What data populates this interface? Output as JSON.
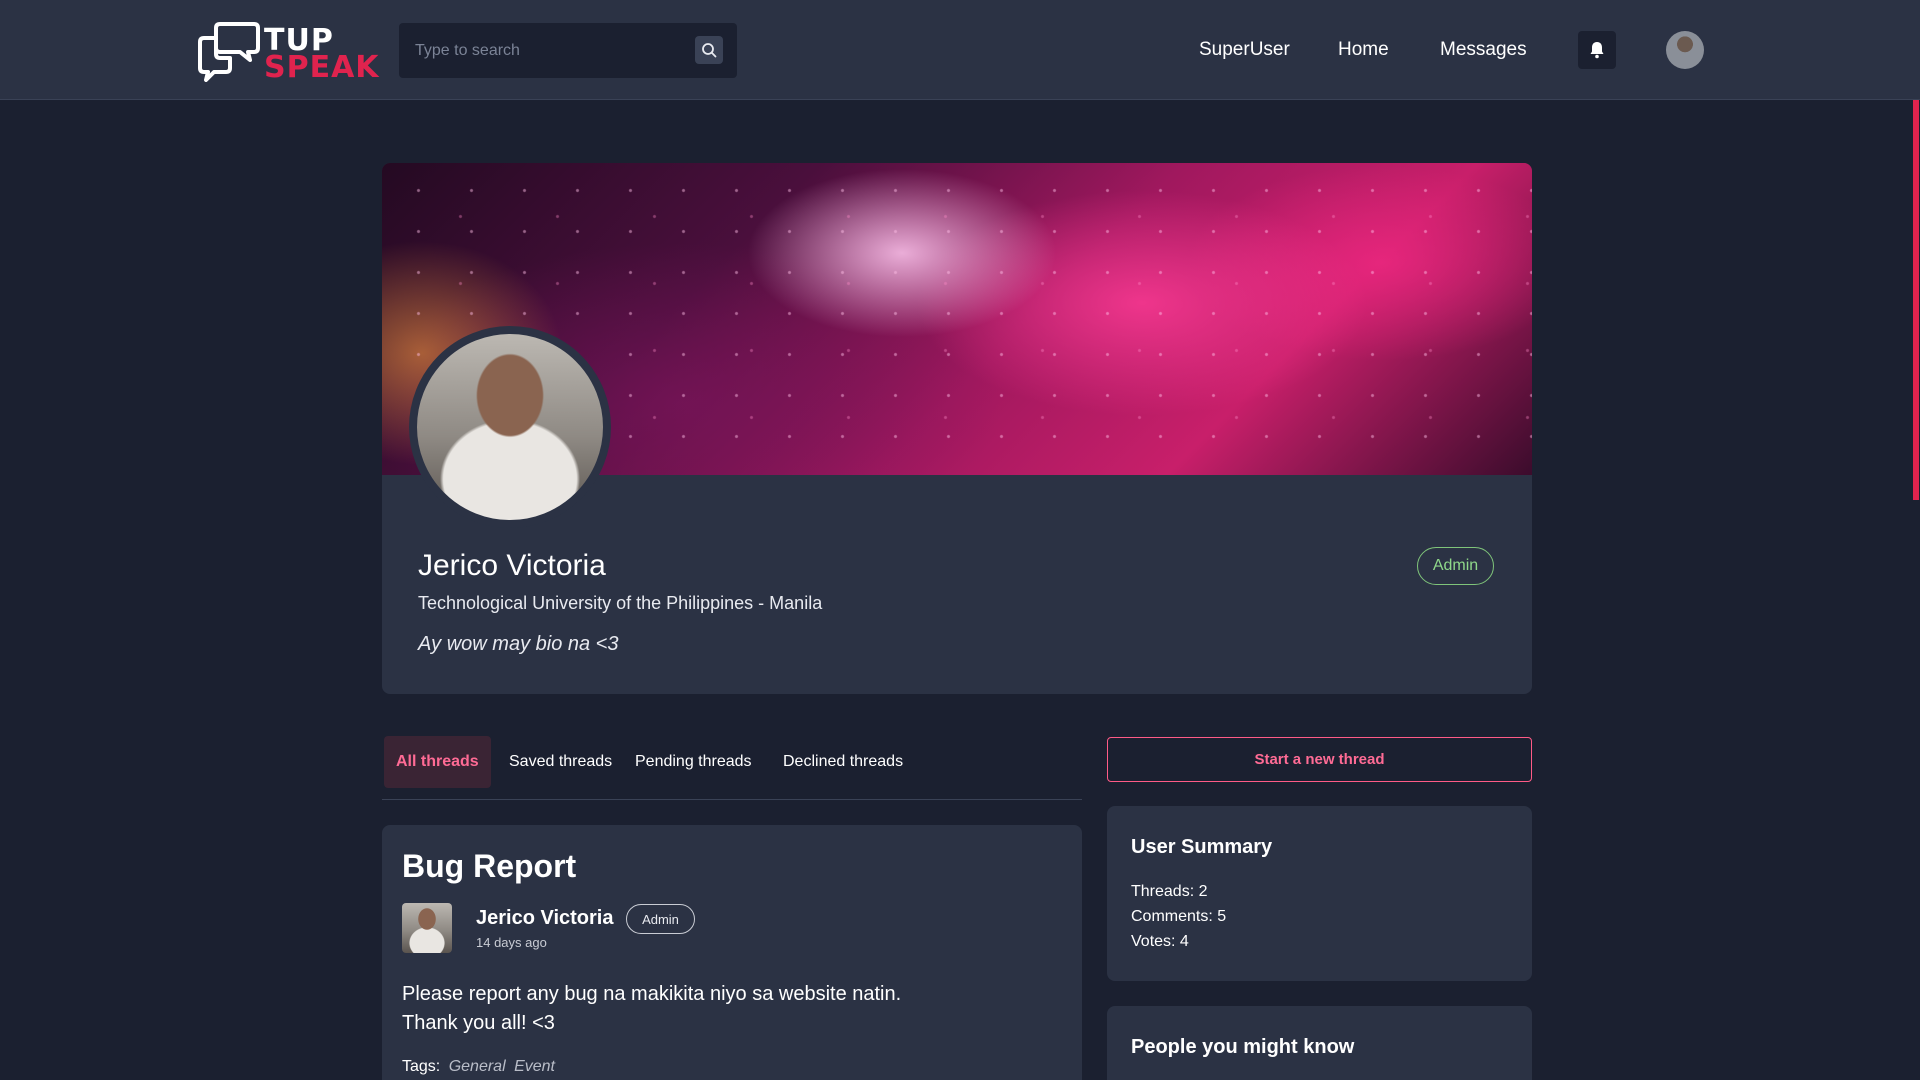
{
  "header": {
    "logo": {
      "line1": "TUP",
      "line2": "SPEAK"
    },
    "search": {
      "placeholder": "Type to search"
    },
    "nav": {
      "superuser": "SuperUser",
      "home": "Home",
      "messages": "Messages"
    }
  },
  "profile": {
    "name": "Jerico Victoria",
    "school": "Technological University of the Philippines - Manila",
    "bio": "Ay wow may bio na <3",
    "role_badge": "Admin"
  },
  "tabs": [
    {
      "label": "All threads",
      "active": true
    },
    {
      "label": "Saved threads",
      "active": false
    },
    {
      "label": "Pending threads",
      "active": false
    },
    {
      "label": "Declined threads",
      "active": false
    }
  ],
  "actions": {
    "start_thread": "Start a new thread"
  },
  "thread": {
    "title": "Bug Report",
    "author": "Jerico Victoria",
    "author_badge": "Admin",
    "time": "14 days ago",
    "body_line1": "Please report any bug na makikita niyo sa website natin.",
    "body_line2": "Thank you all! <3",
    "tags_label": "Tags:",
    "tags": [
      "General",
      "Event"
    ]
  },
  "summary": {
    "title": "User Summary",
    "threads": "Threads: 2",
    "comments": "Comments: 5",
    "votes": "Votes: 4"
  },
  "people": {
    "title": "People you might know"
  },
  "colors": {
    "accent": "#e0234e",
    "accent_text": "#ff6b95",
    "admin_green": "#8fd88a",
    "surface": "#2b3244",
    "background": "#1b2030"
  }
}
